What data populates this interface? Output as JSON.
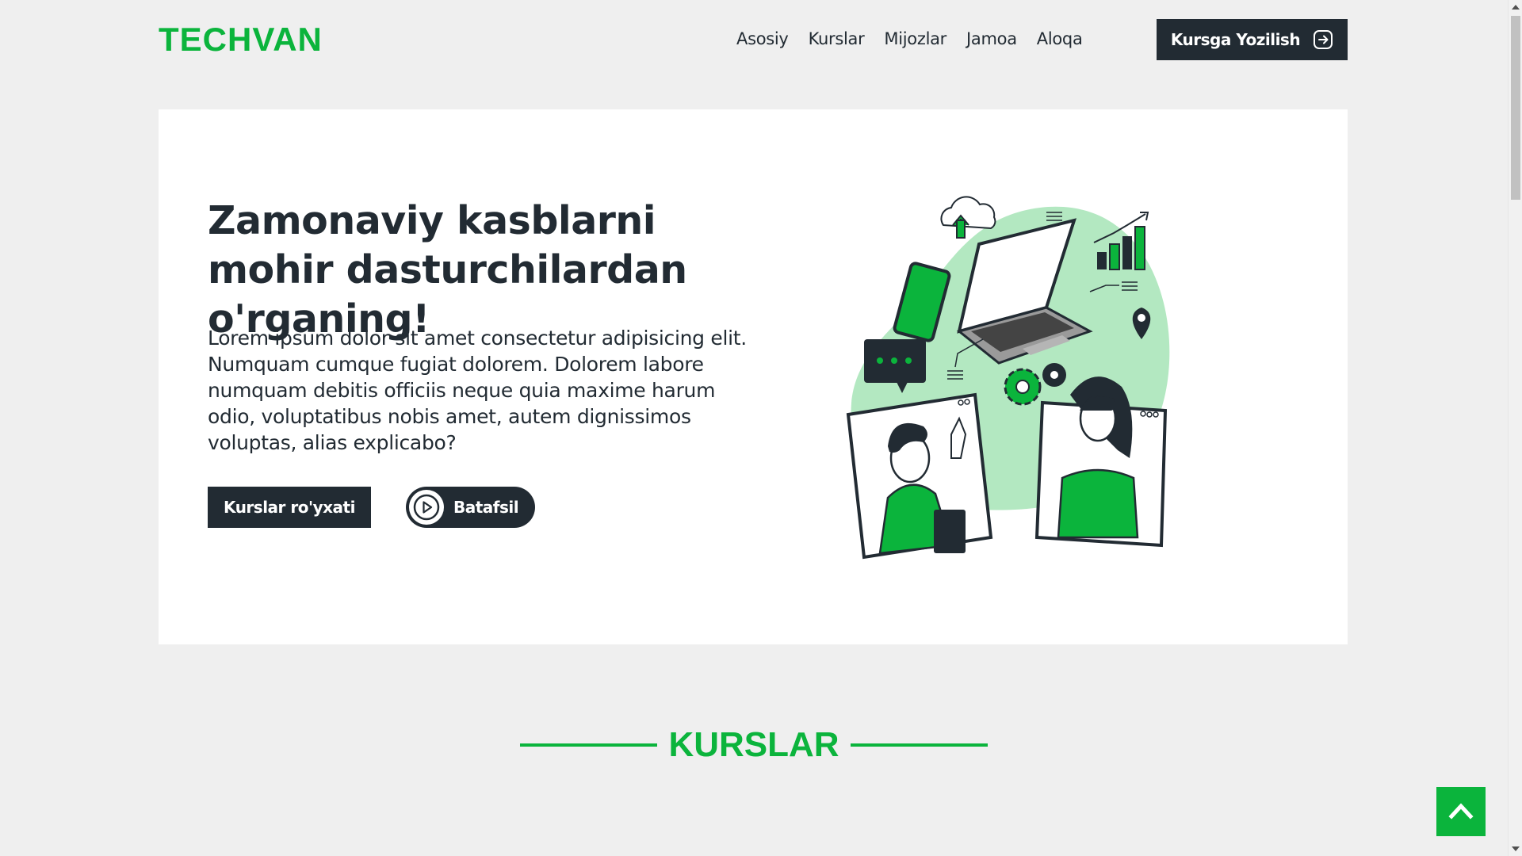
{
  "header": {
    "logo": "TECHVAN",
    "nav": [
      "Asosiy",
      "Kurslar",
      "Mijozlar",
      "Jamoa",
      "Aloqa"
    ],
    "enroll_label": "Kursga Yozilish"
  },
  "hero": {
    "title": "Zamonaviy kasblarni mohir dasturchilardan o'rganing!",
    "text": "Lorem ipsum dolor sit amet consectetur adipisicing elit. Numquam cumque fugiat dolorem. Dolorem labore numquam debitis officiis neque quia maxime harum odio, voluptatibus nobis amet, autem dignissimos voluptas, alias explicabo?",
    "btn_courses": "Kurslar ro'yxati",
    "btn_more": "Batafsil"
  },
  "section": {
    "title": "KURSLAR"
  },
  "colors": {
    "accent": "#0bb43c",
    "dark": "#222b33",
    "background": "#efefef"
  },
  "icons": {
    "enroll": "arrow-right-in-square-icon",
    "more": "play-circle-icon",
    "to_top": "chevron-up-icon"
  }
}
